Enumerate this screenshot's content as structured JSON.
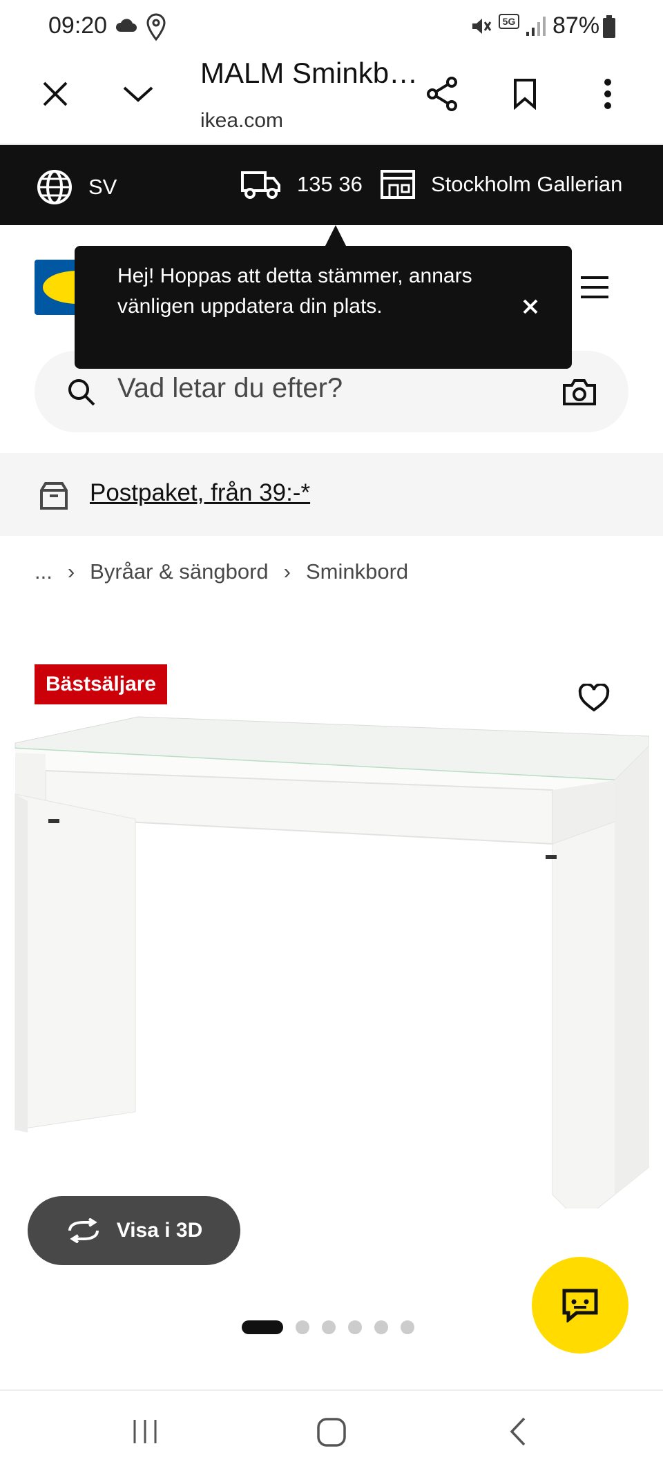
{
  "status_bar": {
    "time": "09:20",
    "network": "5G",
    "battery": "87%"
  },
  "browser": {
    "title": "MALM Sminkbord",
    "domain": "ikea.com"
  },
  "location_bar": {
    "language": "SV",
    "postcode": "135 36",
    "store": "Stockholm Gallerian"
  },
  "tooltip": {
    "text": "Hej! Hoppas att detta stämmer, annars vänligen uppdatera din plats."
  },
  "search": {
    "placeholder": "Vad letar du efter?"
  },
  "promo": {
    "text": "Postpaket, från 39:-*"
  },
  "breadcrumb": {
    "ellipsis": "...",
    "items": [
      "Byråar & sängbord",
      "Sminkbord"
    ]
  },
  "product": {
    "badge": "Bästsäljare",
    "view_3d_label": "Visa i 3D",
    "carousel_count": 6,
    "carousel_active": 1
  },
  "colors": {
    "ikea_blue": "#0058a3",
    "ikea_yellow": "#ffdb00",
    "badge_red": "#cc0008"
  }
}
